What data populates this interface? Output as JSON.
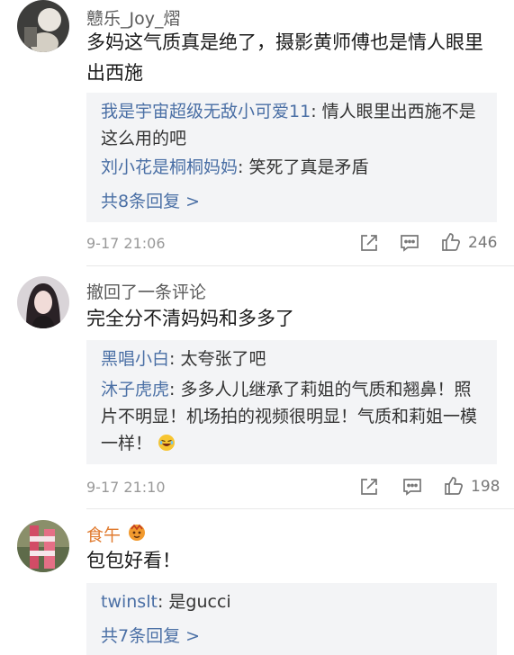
{
  "comments": [
    {
      "username": "戆乐_Joy_熠",
      "text": "多妈这气质真是绝了，摄影黄师傅也是情人眼里出西施",
      "replies": [
        {
          "name": "我是宇宙超级无敌小可爱11",
          "text": "情人眼里出西施不是这么用的吧"
        },
        {
          "name": "刘小花是桐桐妈妈",
          "text": "笑死了真是矛盾"
        }
      ],
      "more_replies": "共8条回复 >",
      "time": "9-17 21:06",
      "likes": "246"
    },
    {
      "username": "撤回了一条评论",
      "text": "完全分不清妈妈和多多了",
      "replies": [
        {
          "name": "黑唱小白",
          "text": "太夸张了吧"
        },
        {
          "name": "沐子虎虎",
          "text": "多多人儿继承了莉姐的气质和翘鼻！照片不明显！机场拍的视频很明显！气质和莉姐一模一样！",
          "emoji": "laughing-emoji"
        }
      ],
      "time": "9-17 21:10",
      "likes": "198"
    },
    {
      "username": "食午",
      "text": "包包好看！",
      "replies": [
        {
          "name": "twinslt",
          "text": "是gucci"
        }
      ],
      "more_replies": "共7条回复 >"
    }
  ],
  "colors": {
    "reply_name": "#4a6fa5",
    "reply_bg": "#f3f4f6",
    "meta": "#999999"
  },
  "icons": [
    "share-icon",
    "comment-icon",
    "like-icon",
    "badge-icon"
  ]
}
